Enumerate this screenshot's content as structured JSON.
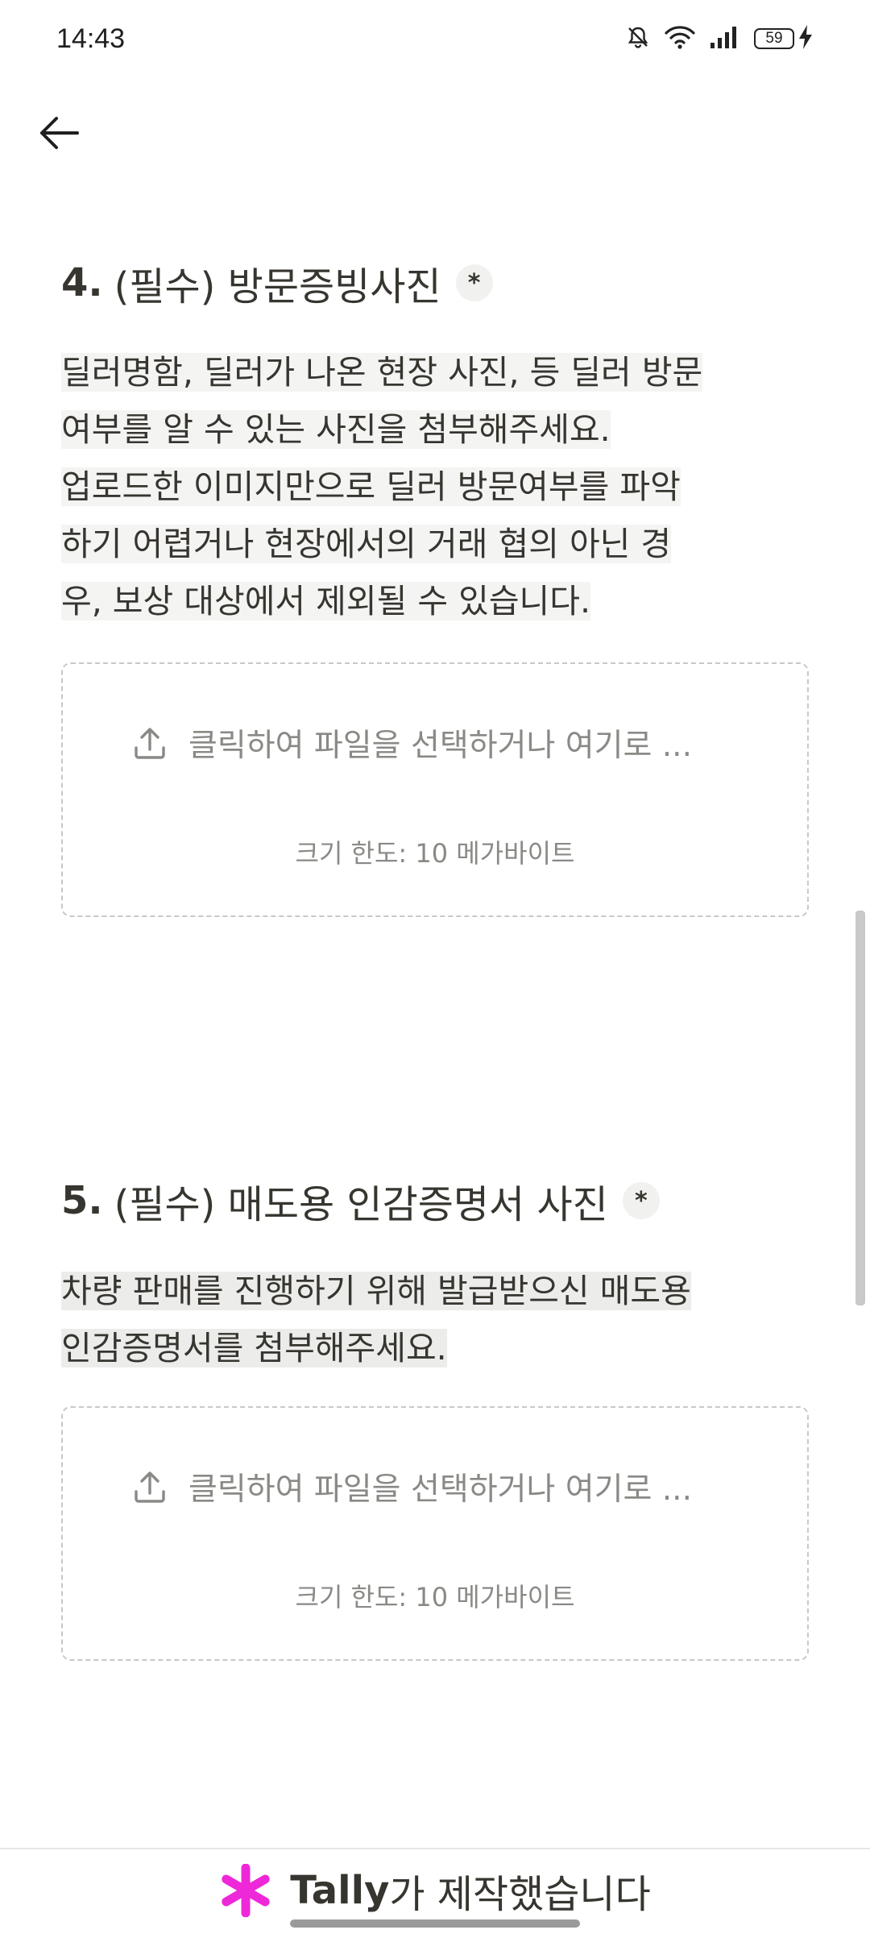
{
  "status": {
    "time": "14:43",
    "battery": "59"
  },
  "questions": [
    {
      "number": "4.",
      "title": "(필수) 방문증빙사진",
      "required_mark": "*",
      "description_lines": [
        "딜러명함, 딜러가 나온 현장 사진, 등 딜러 방문",
        "여부를 알 수 있는 사진을 첨부해주세요.",
        "업로드한 이미지만으로 딜러 방문여부를 파악",
        "하기 어렵거나 현장에서의 거래 협의 아닌 경",
        "우, 보상 대상에서 제외될 수 있습니다."
      ],
      "upload_prompt": "클릭하여 파일을 선택하거나 여기로 ...",
      "size_limit": "크기 한도: 10 메가바이트"
    },
    {
      "number": "5.",
      "title": "(필수) 매도용 인감증명서 사진",
      "required_mark": "*",
      "description_lines": [
        "차량 판매를 진행하기 위해 발급받으신 매도용",
        "인감증명서를 첨부해주세요."
      ],
      "upload_prompt": "클릭하여 파일을 선택하거나 여기로 ...",
      "size_limit": "크기 한도: 10 메가바이트"
    }
  ],
  "footer": {
    "brand": "Tally",
    "suffix": "가 제작했습니다"
  },
  "colors": {
    "text": "#37352f",
    "muted": "#8a8985",
    "tally_pink": "#ee28d8"
  }
}
